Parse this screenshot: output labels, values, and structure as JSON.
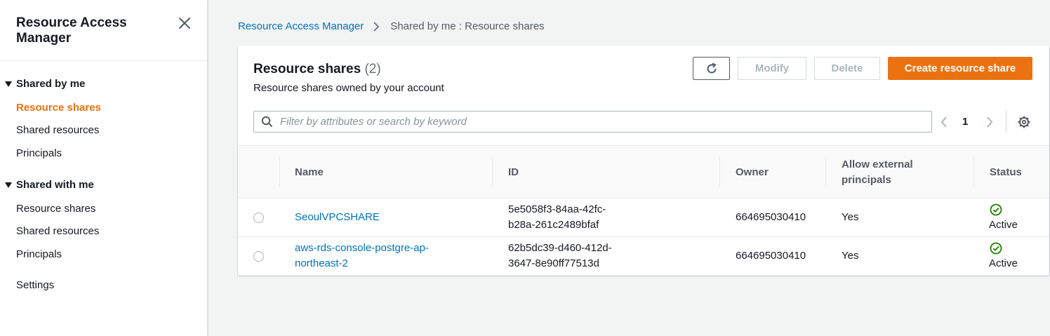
{
  "sidebar": {
    "title": "Resource Access Manager",
    "sections": [
      {
        "label": "Shared by me",
        "items": [
          "Resource shares",
          "Shared resources",
          "Principals"
        ]
      },
      {
        "label": "Shared with me",
        "items": [
          "Resource shares",
          "Shared resources",
          "Principals"
        ]
      }
    ],
    "settings": "Settings"
  },
  "breadcrumb": {
    "root": "Resource Access Manager",
    "current": "Shared by me : Resource shares"
  },
  "panel": {
    "title": "Resource shares",
    "count": "(2)",
    "description": "Resource shares owned by your account",
    "modify_label": "Modify",
    "delete_label": "Delete",
    "create_label": "Create resource share",
    "search_placeholder": "Filter by attributes or search by keyword",
    "page": "1"
  },
  "table": {
    "headers": {
      "name": "Name",
      "id": "ID",
      "owner": "Owner",
      "external": "Allow external principals",
      "status": "Status"
    },
    "rows": [
      {
        "name": "SeoulVPCSHARE",
        "id_line1": "5e5058f3-84aa-42fc-",
        "id_line2": "b28a-261c2489bfaf",
        "owner": "664695030410",
        "external": "Yes",
        "status": "Active"
      },
      {
        "name_line1": "aws-rds-console-postgre-ap-",
        "name_line2": "northeast-2",
        "id_line1": "62b5dc39-d460-412d-",
        "id_line2": "3647-8e90ff77513d",
        "owner": "664695030410",
        "external": "Yes",
        "status": "Active"
      }
    ]
  },
  "colors": {
    "accent": "#ec7211",
    "link": "#0073bb",
    "success": "#1d8102"
  }
}
